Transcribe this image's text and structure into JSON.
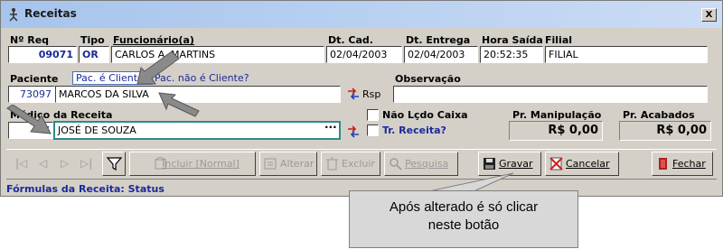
{
  "window": {
    "title": "Receitas",
    "close_label": "X"
  },
  "labels": {
    "nreq": "Nº Req",
    "tipo": "Tipo",
    "funcionario": "Funcionário(a)",
    "dtcad": "Dt. Cad.",
    "dtentrega": "Dt. Entrega",
    "horasaida": "Hora Saída",
    "filial": "Filial",
    "paciente": "Paciente",
    "observacao": "Observação",
    "medico": "Médico da Receita",
    "nao_lcdo_caixa": "Não Lçdo Caixa",
    "tr_receita": "Tr. Receita?",
    "pr_manipulacao": "Pr. Manipulação",
    "pr_acabados": "Pr. Acabados",
    "rsp": "Rsp"
  },
  "fields": {
    "nreq": "09071",
    "tipo": "OR",
    "funcionario": "CARLOS A. MARTINS",
    "dtcad": "02/04/2003",
    "dtentrega": "02/04/2003",
    "horasaida": "20:52:35",
    "filial": "FILIAL",
    "paciente_cod": "73097",
    "paciente_nome": "MARCOS DA SILVA",
    "observacao": "",
    "medico_cod": "7",
    "medico_nome": "JOSÉ DE SOUZA",
    "pr_manipulacao": "R$ 0,00",
    "pr_acabados": "R$ 0,00"
  },
  "links": {
    "pac_cliente": "Pac. é Cliente?",
    "pac_nao_cliente": "Pac. não é Cliente?"
  },
  "toolbar": {
    "incluir": "Incluir [Normal]",
    "alterar": "Alterar",
    "excluir": "Excluir",
    "pesquisa": "Pesquisa",
    "gravar": "Gravar",
    "cancelar": "Cancelar",
    "fechar": "Fechar"
  },
  "section": {
    "formulas": "Fórmulas da Receita: Status"
  },
  "callout": {
    "line1": "Após alterado é só clicar",
    "line2": "neste botão"
  },
  "colors": {
    "titlebar": "#a6c4ec",
    "window": "#d4d0c8",
    "link_blue": "#1a2a9a",
    "teal": "#2e8a8a"
  }
}
